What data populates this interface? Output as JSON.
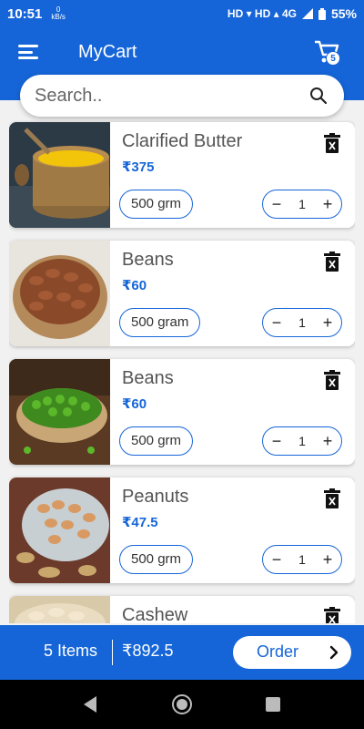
{
  "status": {
    "time": "10:51",
    "speed_value": "0",
    "speed_unit": "kB/s",
    "network": "HD ▾ HD ▴ 4G",
    "battery": "55%"
  },
  "header": {
    "title": "MyCart",
    "cart_count": "5"
  },
  "search": {
    "placeholder": "Search.."
  },
  "cart_items": [
    {
      "name": "Clarified Butter",
      "price": "₹375",
      "weight": "500 grm",
      "qty": "1"
    },
    {
      "name": "Beans",
      "price": "₹60",
      "weight": "500 gram",
      "qty": "1"
    },
    {
      "name": "Beans",
      "price": "₹60",
      "weight": "500 grm",
      "qty": "1"
    },
    {
      "name": "Peanuts",
      "price": "₹47.5",
      "weight": "500 grm",
      "qty": "1"
    },
    {
      "name": "Cashew",
      "price": "",
      "weight": "",
      "qty": ""
    }
  ],
  "stepper": {
    "minus": "−",
    "plus": "+"
  },
  "footer": {
    "items_label": "5 Items",
    "total": "₹892.5",
    "order_label": "Order"
  },
  "colors": {
    "accent": "#1565d8",
    "background": "#f1f1f1"
  }
}
